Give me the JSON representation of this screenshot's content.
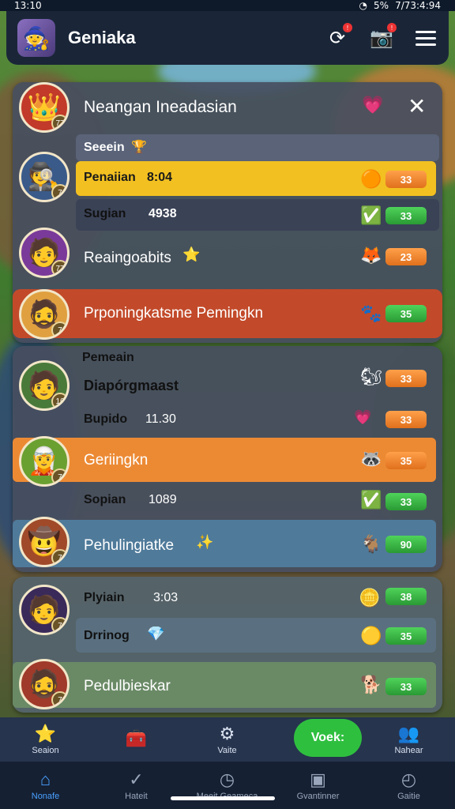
{
  "status": {
    "time": "13:10",
    "battery": "5%",
    "right_text": "7/73:4:94"
  },
  "app": {
    "title": "Geniaka",
    "avatar_icon": "wizard-avatar-icon"
  },
  "panel1": {
    "header": "Neangan Ineadasian",
    "section_label": "Seeein",
    "rows": [
      {
        "name": "Penaiian",
        "extra": "8:04",
        "pill": "33",
        "pill_color": "orange"
      },
      {
        "name": "Sugian",
        "extra": "4938",
        "pill": "33",
        "pill_color": "green"
      },
      {
        "name": "Reaingoabits",
        "extra": "",
        "pill": "23",
        "pill_color": "orange"
      },
      {
        "name": "Prponingkatsme Pemingkn",
        "extra": "",
        "pill": "35",
        "pill_color": "green"
      }
    ]
  },
  "panel2": {
    "section_label": "Pemeain",
    "rows": [
      {
        "name": "Diapórgmaast",
        "extra": "",
        "pill": "33",
        "pill_color": "orange"
      },
      {
        "name": "Bupido",
        "extra": "11.30",
        "pill": "33",
        "pill_color": "orange"
      },
      {
        "name": "Geriingkn",
        "extra": "",
        "pill": "35",
        "pill_color": "orange"
      },
      {
        "name": "Sopian",
        "extra": "1089",
        "pill": "33",
        "pill_color": "green"
      },
      {
        "name": "Pehulingiatke",
        "extra": "",
        "pill": "90",
        "pill_color": "green"
      }
    ]
  },
  "panel3": {
    "rows": [
      {
        "name": "Plyiain",
        "extra": "3:03",
        "pill": "38",
        "pill_color": "green"
      },
      {
        "name": "Drrinog",
        "extra": "",
        "pill": "35",
        "pill_color": "green"
      },
      {
        "name": "Pedulbieskar",
        "extra": "",
        "pill": "33",
        "pill_color": "green"
      }
    ]
  },
  "tabs_top": [
    "Seaion",
    "",
    "Vaite",
    "",
    "Nahear"
  ],
  "cta": {
    "label": "Voek:"
  },
  "tabs_bottom": [
    "Nonafe",
    "Hateit",
    "Meeit Geameca",
    "Gvantinner",
    "Gaitie"
  ]
}
